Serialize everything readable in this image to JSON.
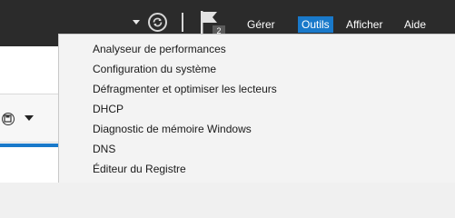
{
  "header": {
    "flag_badge": "2",
    "menu": {
      "manage": "Gérer",
      "tools": "Outils",
      "view": "Afficher",
      "help": "Aide"
    }
  },
  "tools_menu": {
    "items": [
      "Analyseur de performances",
      "Configuration du système",
      "Défragmenter et optimiser les lecteurs",
      "DHCP",
      "Diagnostic de mémoire Windows",
      "DNS",
      "Éditeur du Registre"
    ]
  },
  "colors": {
    "header_bg": "#2b2b2b",
    "accent": "#1979ca",
    "menu_bg": "#f3f3f3"
  },
  "icons": {
    "refresh": "refresh-icon",
    "flag": "notifications-flag-icon",
    "save": "save-icon"
  }
}
